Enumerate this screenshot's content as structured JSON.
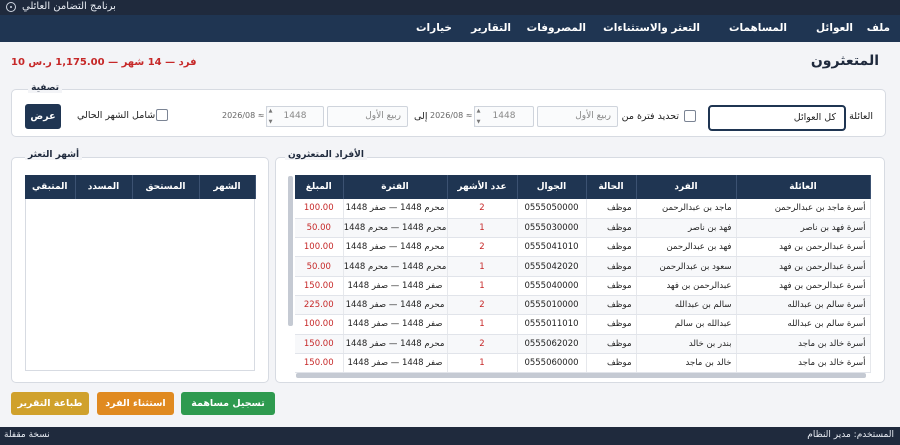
{
  "window": {
    "title": "برنامج التضامن العائلي"
  },
  "menu": {
    "file": "ملف",
    "families": "العوائل",
    "contributions": "المساهمات",
    "defaulters": "التعثر والاستثناءات",
    "expenses": "المصروفات",
    "reports": "التقارير",
    "options": "خيارات"
  },
  "page": {
    "title": "المتعثرون",
    "summary": "10 فرد — 14 شهر — 1,175.00 ر.س"
  },
  "filter": {
    "section_title": "تصفية",
    "family_label": "العائلة",
    "family_value": "كل العوائل",
    "period_label": "تحديد فترة من",
    "from_month_placeholder": "ربيع الأول",
    "from_year": "1448",
    "from_date_hint": "2026/08 ≈",
    "to_label": "إلى",
    "to_month_placeholder": "ربيع الأول",
    "to_year": "1448",
    "to_date_hint": "2026/08 ≈",
    "current_month_label": "شامل الشهر الحالي",
    "show_button": "عرض"
  },
  "members_section": {
    "title": "الأفراد المتعثرون",
    "columns": [
      "العائلة",
      "الفرد",
      "الحالة",
      "الجوال",
      "عدد الأشهر",
      "الفترة",
      "المبلغ"
    ],
    "rows": [
      [
        "أسرة ماجد بن عبدالرحمن",
        "ماجد بن عبدالرحمن",
        "موظف",
        "0555050000",
        "2",
        "محرم 1448 — صفر 1448",
        "100.00"
      ],
      [
        "أسرة فهد بن ناصر",
        "فهد بن ناصر",
        "موظف",
        "0555030000",
        "1",
        "محرم 1448 — محرم 1448",
        "50.00"
      ],
      [
        "أسرة عبدالرحمن بن فهد",
        "فهد بن عبدالرحمن",
        "موظف",
        "0555041010",
        "2",
        "محرم 1448 — صفر 1448",
        "100.00"
      ],
      [
        "أسرة عبدالرحمن بن فهد",
        "سعود بن عبدالرحمن",
        "موظف",
        "0555042020",
        "1",
        "محرم 1448 — محرم 1448",
        "50.00"
      ],
      [
        "أسرة عبدالرحمن بن فهد",
        "عبدالرحمن بن فهد",
        "موظف",
        "0555040000",
        "1",
        "صفر 1448 — صفر 1448",
        "150.00"
      ],
      [
        "أسرة سالم بن عبدالله",
        "سالم بن عبدالله",
        "موظف",
        "0555010000",
        "2",
        "محرم 1448 — صفر 1448",
        "225.00"
      ],
      [
        "أسرة سالم بن عبدالله",
        "عبدالله بن سالم",
        "موظف",
        "0555011010",
        "1",
        "صفر 1448 — صفر 1448",
        "100.00"
      ],
      [
        "أسرة خالد بن ماجد",
        "بندر بن خالد",
        "موظف",
        "0555062020",
        "2",
        "محرم 1448 — صفر 1448",
        "150.00"
      ],
      [
        "أسرة خالد بن ماجد",
        "خالد بن ماجد",
        "موظف",
        "0555060000",
        "1",
        "صفر 1448 — صفر 1448",
        "150.00"
      ]
    ]
  },
  "months_section": {
    "title": "أشهر التعثر",
    "columns": [
      "الشهر",
      "المستحق",
      "المسدد",
      "المتبقي"
    ]
  },
  "actions": {
    "register": "تسجيل مساهمة",
    "exclude": "استثناء الفرد",
    "print": "طباعة التقرير"
  },
  "status": {
    "user": "المستخدم: مدير النظام",
    "backup": "نسخة مقفلة"
  },
  "colors": {
    "navy": "#1f3552",
    "register_green": "#2e9a4f",
    "exclude_orange": "#e08a20",
    "print_gold": "#d0a12c",
    "alert_red": "#c62828"
  }
}
